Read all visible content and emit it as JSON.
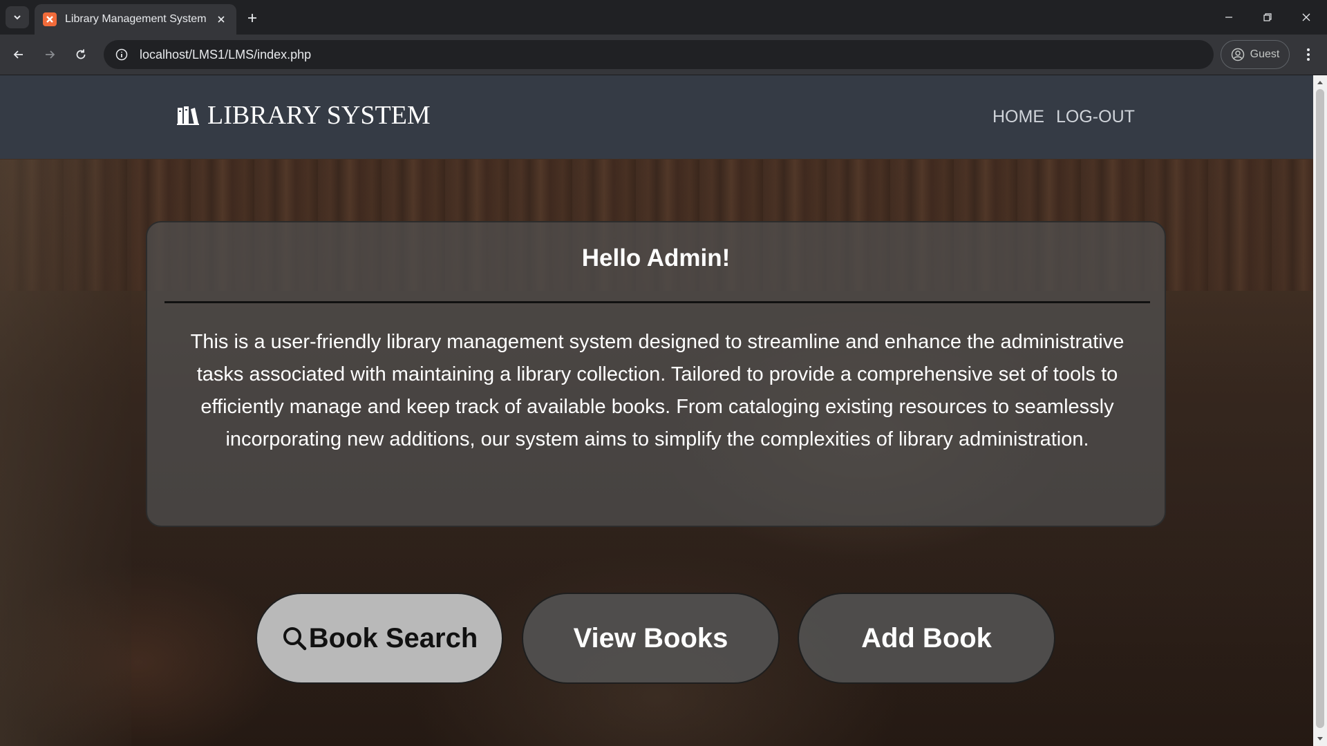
{
  "browser": {
    "tab_title": "Library Management System",
    "url": "localhost/LMS1/LMS/index.php",
    "profile_label": "Guest"
  },
  "header": {
    "brand": "LIBRARY SYSTEM",
    "nav": {
      "home": "HOME",
      "logout": "LOG-OUT"
    }
  },
  "hello": {
    "title": "Hello Admin!",
    "body": "This is a user-friendly library management system designed to streamline and enhance the administrative tasks associated with maintaining a library collection. Tailored to provide a comprehensive set of tools to efficiently manage and keep track of available books. From cataloging existing resources to seamlessly incorporating new additions, our system aims to simplify the complexities of library administration."
  },
  "actions": {
    "search": "Book Search",
    "view": "View Books",
    "add": "Add Book"
  },
  "icons": {
    "brand": "library-books-icon",
    "search": "magnifier-icon"
  },
  "colors": {
    "header_bg": "#353b45",
    "search_button_bg": "#b9b9b9",
    "favicon": "#f26b3a"
  }
}
